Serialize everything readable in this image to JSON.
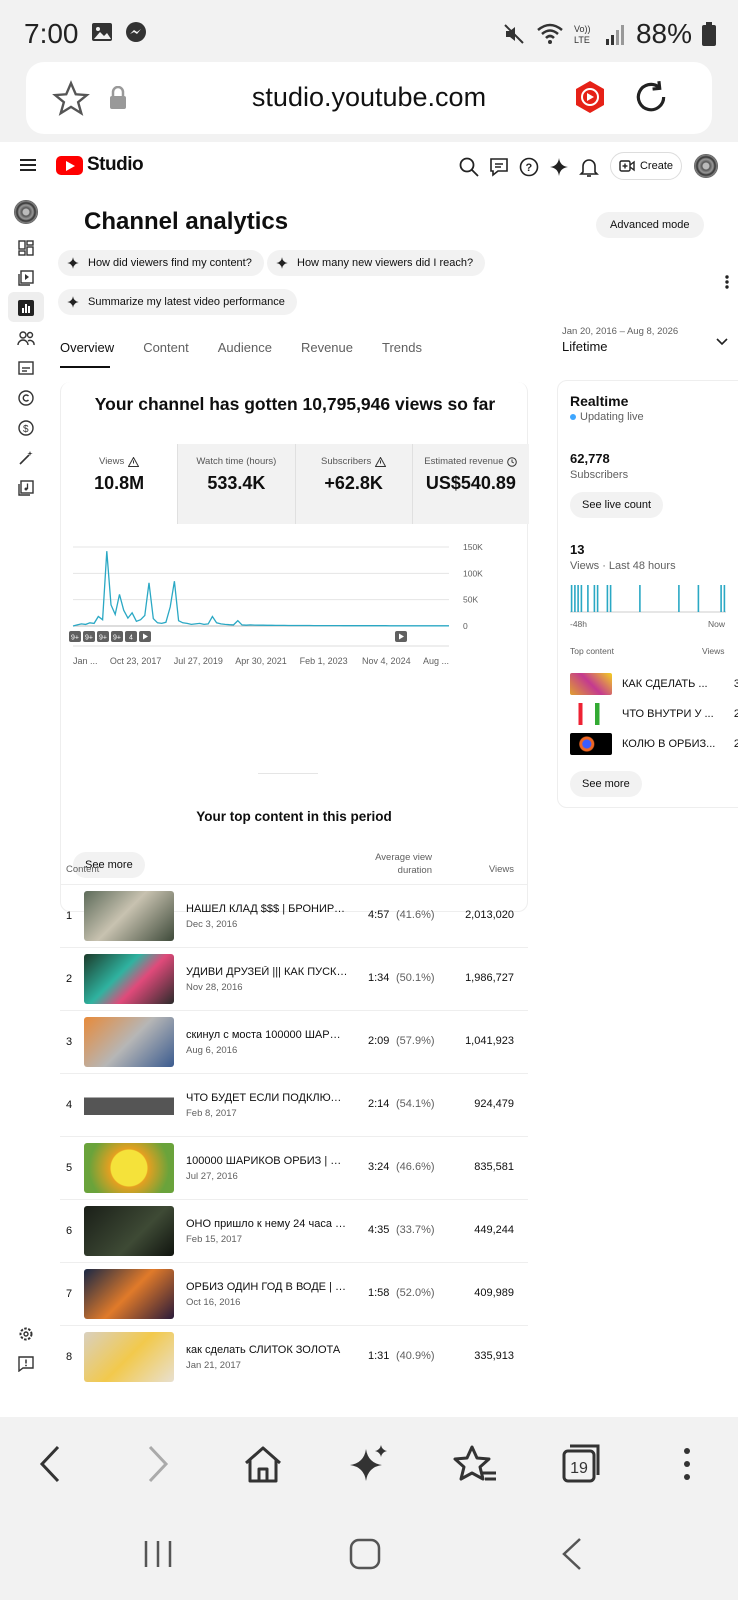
{
  "status": {
    "time": "7:00",
    "battery": "88%"
  },
  "browser": {
    "url": "studio.youtube.com",
    "tabs_count": "19"
  },
  "studio": {
    "logo_text": "Studio",
    "create_label": "Create",
    "page_title": "Channel analytics",
    "advanced_mode": "Advanced mode",
    "suggestions": [
      "How did viewers find my content?",
      "How many new viewers did I reach?",
      "Summarize my latest video performance"
    ],
    "tabs": [
      "Overview",
      "Content",
      "Audience",
      "Revenue",
      "Trends"
    ],
    "date_range": "Jan 20, 2016 – Aug 8, 2026",
    "period": "Lifetime",
    "headline": "Your channel has gotten 10,795,946 views so far",
    "metrics": [
      {
        "label": "Views",
        "value": "10.8M"
      },
      {
        "label": "Watch time (hours)",
        "value": "533.4K"
      },
      {
        "label": "Subscribers",
        "value": "+62.8K"
      },
      {
        "label": "Estimated revenue",
        "value": "US$540.89"
      }
    ],
    "see_more": "See more"
  },
  "chart_data": {
    "type": "line",
    "x_tick_labels": [
      "Jan ...",
      "Oct 23, 2017",
      "Jul 27, 2019",
      "Apr 30, 2021",
      "Feb 1, 2023",
      "Nov 4, 2024",
      "Aug ..."
    ],
    "y_tick_labels": [
      "150K",
      "100K",
      "50K",
      "0"
    ],
    "ylim": [
      0,
      150000
    ],
    "series": [
      {
        "color": "#2aa8c4",
        "values": [
          0,
          2000,
          4000,
          3000,
          6000,
          5000,
          18000,
          12000,
          142000,
          40000,
          22000,
          60000,
          30000,
          15000,
          25000,
          9000,
          12000,
          20000,
          82000,
          14000,
          6000,
          5000,
          7000,
          36000,
          85000,
          10000,
          6000,
          5000,
          3000,
          4000,
          5000,
          3000,
          4000,
          18000,
          6000,
          4000,
          3000,
          2500,
          2000,
          10000,
          2000,
          1500,
          2000,
          1800,
          1500,
          1500,
          1400,
          1300,
          1200,
          1100,
          1100,
          1000,
          1000,
          1000,
          900,
          900,
          900,
          800,
          800,
          800,
          700,
          700,
          700,
          700,
          600,
          600,
          600,
          600,
          600,
          500,
          500,
          500,
          500,
          500,
          500,
          400,
          400,
          400,
          400,
          400,
          400,
          300,
          300,
          300,
          300,
          300,
          300,
          300,
          300,
          300
        ]
      }
    ],
    "annotations": [
      "9+",
      "9+",
      "9+",
      "9+",
      "4"
    ]
  },
  "realtime": {
    "title": "Realtime",
    "live": "Updating live",
    "subs": "62,778",
    "subs_label": "Subscribers",
    "live_count_btn": "See live count",
    "views": "13",
    "views_label": "Views · Last 48 hours",
    "from": "-48h",
    "to": "Now",
    "top_content": "Top content",
    "views_col": "Views",
    "items": [
      {
        "title": "КАК СДЕЛАТЬ ...",
        "views": "3"
      },
      {
        "title": "ЧТО ВНУТРИ У ...",
        "views": "2"
      },
      {
        "title": "КОЛЮ В ОРБИЗ...",
        "views": "2"
      }
    ],
    "bars": [
      1,
      1,
      1,
      1,
      0,
      1,
      0,
      1,
      1,
      0,
      0,
      1,
      1,
      0,
      0,
      0,
      0,
      0,
      0,
      0,
      0,
      1,
      0,
      0,
      0,
      0,
      0,
      0,
      0,
      0,
      0,
      0,
      0,
      1,
      0,
      0,
      0,
      0,
      0,
      1,
      0,
      0,
      0,
      0,
      0,
      0,
      1,
      1
    ]
  },
  "top_content": {
    "title": "Your top content in this period",
    "col_content": "Content",
    "col_avd": "Average view duration",
    "col_views": "Views",
    "rows": [
      {
        "n": "1",
        "title": "НАШЕЛ КЛАД $$$ | БРОНИРОВ...",
        "date": "Dec 3, 2016",
        "dur": "4:57",
        "pct": "(41.6%)",
        "views": "2,013,020"
      },
      {
        "n": "2",
        "title": "УДИВИ ДРУЗЕЙ ||| КАК ПУСКАТ...",
        "date": "Nov 28, 2016",
        "dur": "1:34",
        "pct": "(50.1%)",
        "views": "1,986,727"
      },
      {
        "n": "3",
        "title": "скинул с моста 100000 ШАРИК...",
        "date": "Aug 6, 2016",
        "dur": "2:09",
        "pct": "(57.9%)",
        "views": "1,041,923"
      },
      {
        "n": "4",
        "title": "ЧТО БУДЕТ ЕСЛИ ПОДКЛЮЧИ...",
        "date": "Feb 8, 2017",
        "dur": "2:14",
        "pct": "(54.1%)",
        "views": "924,479"
      },
      {
        "n": "5",
        "title": "100000 ШАРИКОВ ОРБИЗ | СА...",
        "date": "Jul 27, 2016",
        "dur": "3:24",
        "pct": "(46.6%)",
        "views": "835,581"
      },
      {
        "n": "6",
        "title": "ОНО пришло к нему 24 часа по...",
        "date": "Feb 15, 2017",
        "dur": "4:35",
        "pct": "(33.7%)",
        "views": "449,244"
      },
      {
        "n": "7",
        "title": "ОРБИЗ ОДИН ГОД В ВОДЕ | ПР...",
        "date": "Oct 16, 2016",
        "dur": "1:58",
        "pct": "(52.0%)",
        "views": "409,989"
      },
      {
        "n": "8",
        "title": "как сделать СЛИТОК ЗОЛОТА",
        "date": "Jan 21, 2017",
        "dur": "1:31",
        "pct": "(40.9%)",
        "views": "335,913"
      }
    ]
  },
  "colors": {
    "accent": "#ff0000",
    "chart": "#2aa8c4",
    "live_dot": "#3ea6ff"
  }
}
